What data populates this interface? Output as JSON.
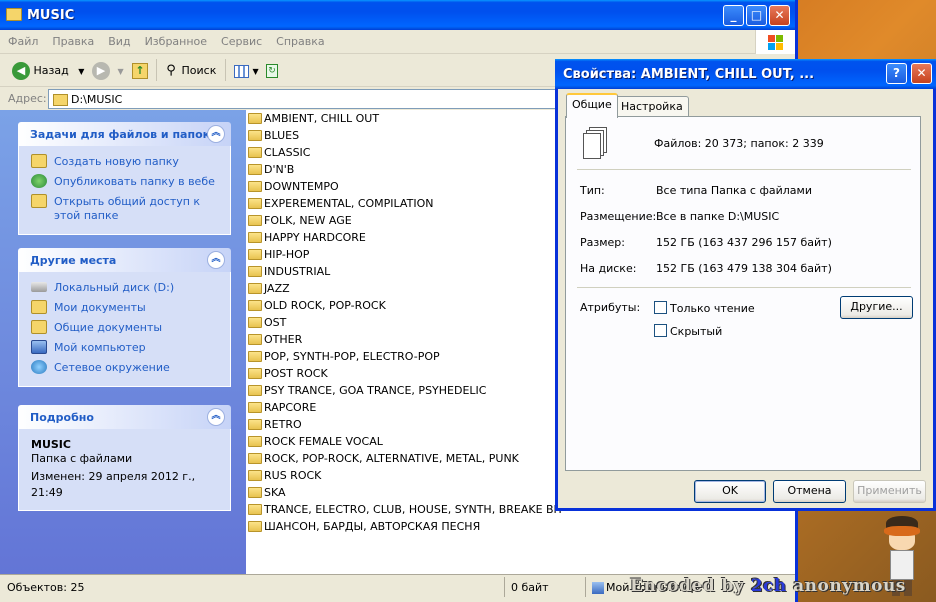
{
  "explorer": {
    "title": "MUSIC",
    "menu": [
      "Файл",
      "Правка",
      "Вид",
      "Избранное",
      "Сервис",
      "Справка"
    ],
    "toolbar": {
      "back": "Назад",
      "search": "Поиск"
    },
    "address": {
      "label": "Адрес:",
      "value": "D:\\MUSIC"
    },
    "tasks": {
      "file_tasks": {
        "title": "Задачи для файлов и папок",
        "items": [
          "Создать новую папку",
          "Опубликовать папку в вебе",
          "Открыть общий доступ к этой папке"
        ]
      },
      "other_places": {
        "title": "Другие места",
        "items": [
          "Локальный диск (D:)",
          "Мои документы",
          "Общие документы",
          "Мой компьютер",
          "Сетевое окружение"
        ]
      },
      "details": {
        "title": "Подробно",
        "name": "MUSIC",
        "type": "Папка с файлами",
        "modified": "Изменен: 29 апреля 2012 г., 21:49"
      }
    },
    "folders": [
      "AMBIENT, CHILL OUT",
      "BLUES",
      "CLASSIC",
      "D'N'B",
      "DOWNTEMPO",
      "EXPEREMENTAL, COMPILATION",
      "FOLK, NEW AGE",
      "HAPPY HARDCORE",
      "HIP-HOP",
      "INDUSTRIAL",
      "JAZZ",
      "OLD ROCK, POP-ROCK",
      "OST",
      "OTHER",
      "POP, SYNTH-POP, ELECTRO-POP",
      "POST ROCK",
      "PSY TRANCE, GOA TRANCE, PSYHEDELIC",
      "RAPCORE",
      "RETRO",
      "ROCK FEMALE VOCAL",
      "ROCK, POP-ROCK, ALTERNATIVE, METAL, PUNK",
      "RUS ROCK",
      "SKA",
      "TRANCE, ELECTRO, CLUB, HOUSE, SYNTH, BREAKE BIT",
      "ШАНСОН, БАРДЫ, АВТОРСКАЯ ПЕСНЯ"
    ],
    "status": {
      "objects": "Объектов: 25",
      "size": "0 байт",
      "location": "Мой компьютер"
    }
  },
  "properties": {
    "title": "Свойства: AMBIENT, CHILL OUT, ...",
    "tabs": [
      "Общие",
      "Настройка"
    ],
    "summary": "Файлов: 20 373; папок: 2 339",
    "rows": [
      {
        "label": "Тип:",
        "value": "Все типа Папка с файлами"
      },
      {
        "label": "Размещение:",
        "value": "Все в папке D:\\MUSIC"
      },
      {
        "label": "Размер:",
        "value": "152 ГБ (163 437 296 157 байт)"
      },
      {
        "label": "На диске:",
        "value": "152 ГБ (163 479 138 304 байт)"
      }
    ],
    "attributes": {
      "label": "Атрибуты:",
      "readonly": "Только чтение",
      "hidden": "Скрытый",
      "other": "Другие..."
    },
    "buttons": {
      "ok": "OK",
      "cancel": "Отмена",
      "apply": "Применить"
    }
  },
  "watermark": {
    "prefix": "Encoded by ",
    "brand": "2ch",
    "suffix": " anonymous"
  }
}
